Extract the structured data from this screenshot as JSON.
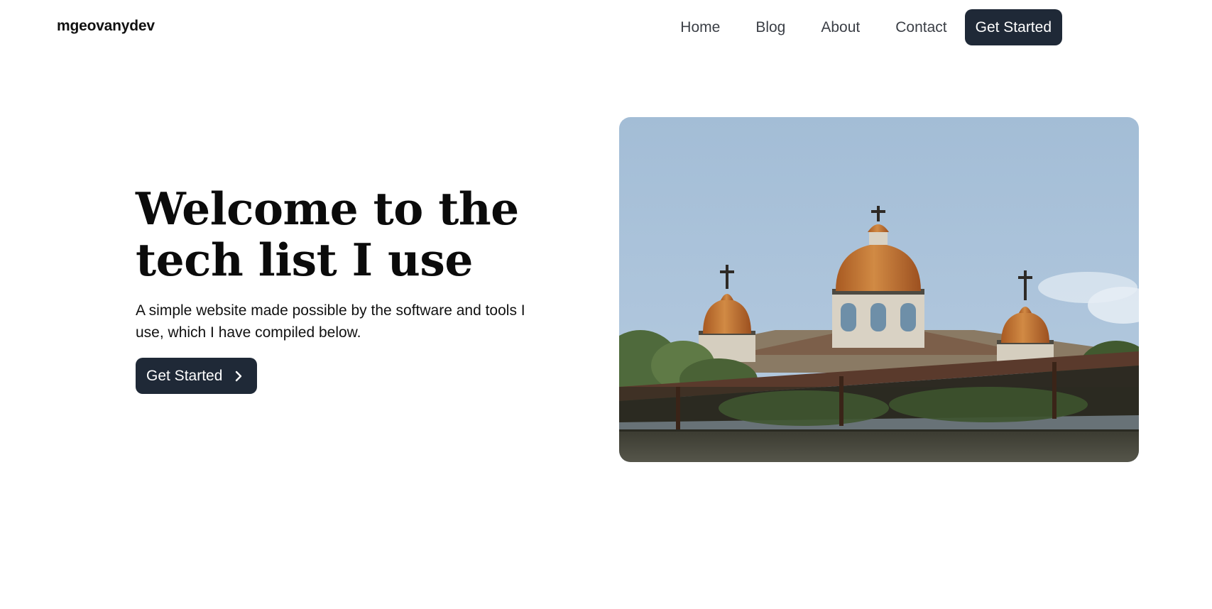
{
  "nav": {
    "brand": "mgeovanydev",
    "links": [
      {
        "label": "Home"
      },
      {
        "label": "Blog"
      },
      {
        "label": "About"
      },
      {
        "label": "Contact"
      }
    ],
    "cta_label": "Get Started"
  },
  "hero": {
    "title_line1": "Welcome to the",
    "title_line2": "tech list I use",
    "subtitle": "A simple website made possible by the software and tools I use, which I have compiled below.",
    "cta_label": "Get Started",
    "cta_icon": "chevron-right-icon",
    "image": {
      "subject": "church domes with crosses against blue sky"
    }
  },
  "colors": {
    "button_bg": "#1f2937",
    "button_text": "#ffffff",
    "text": "#111111",
    "nav_link": "#3b3f46",
    "sky": "#a7bfd6",
    "dome": "#c77a34"
  }
}
